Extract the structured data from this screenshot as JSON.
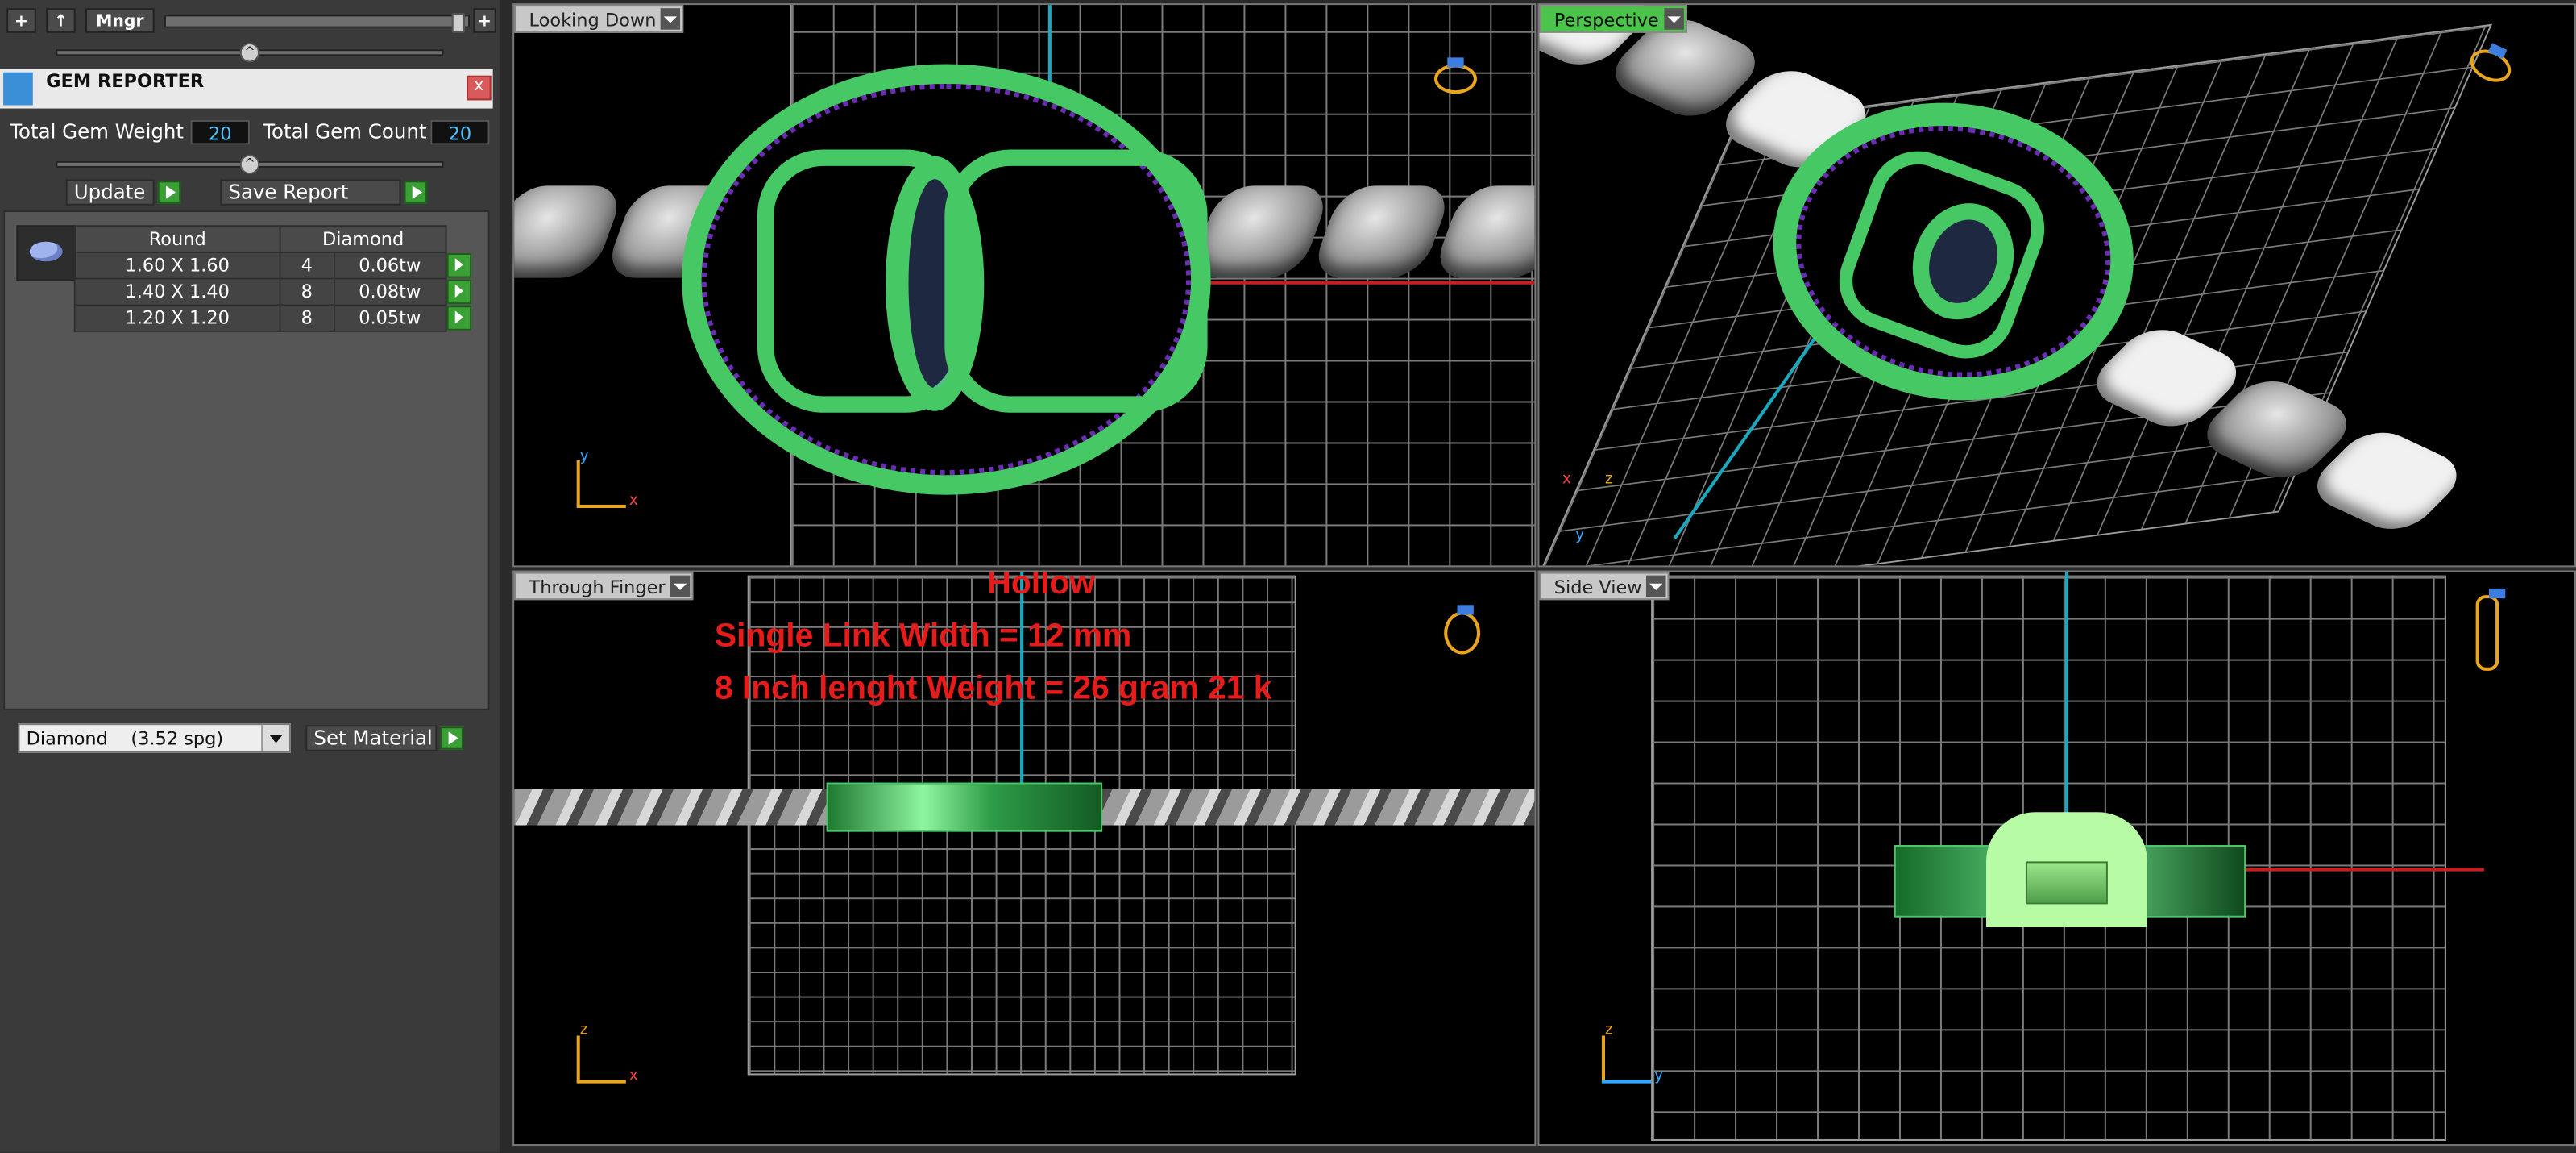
{
  "toolbar": {
    "plus_label": "+",
    "up_label": "↑",
    "mngr_label": "Mngr",
    "plus_right_label": "+"
  },
  "gem_reporter": {
    "title": "GEM REPORTER",
    "close_label": "x",
    "total_weight_label": "Total Gem Weight",
    "total_weight_value": "20",
    "total_count_label": "Total Gem Count",
    "total_count_value": "20",
    "update_label": "Update",
    "save_report_label": "Save Report",
    "table": {
      "header_shape": "Round",
      "header_material": "Diamond",
      "rows": [
        {
          "size": "1.60 X 1.60",
          "count": "4",
          "weight": "0.06tw"
        },
        {
          "size": "1.40 X 1.40",
          "count": "8",
          "weight": "0.08tw"
        },
        {
          "size": "1.20 X 1.20",
          "count": "8",
          "weight": "0.05tw"
        }
      ]
    },
    "material_select": "Diamond    (3.52 spg)",
    "set_material_label": "Set Material"
  },
  "viewports": {
    "top_left": "Looking Down",
    "top_right": "Perspective",
    "bottom_left": "Through Finger",
    "bottom_right": "Side View"
  },
  "overlay": {
    "line1": "Hollow",
    "line2": "Single Link Width = 12 mm",
    "line3": "8 Inch lenght Weight = 26 gram 21 k"
  },
  "axes": {
    "y": "y",
    "x": "x",
    "z": "z"
  },
  "colors": {
    "accent_green": "#46c865",
    "gem_purple": "#6a2cb3",
    "overlay_red": "#e81b1b",
    "axis_red": "#c81e1e",
    "axis_blue": "#1aa8bf"
  }
}
